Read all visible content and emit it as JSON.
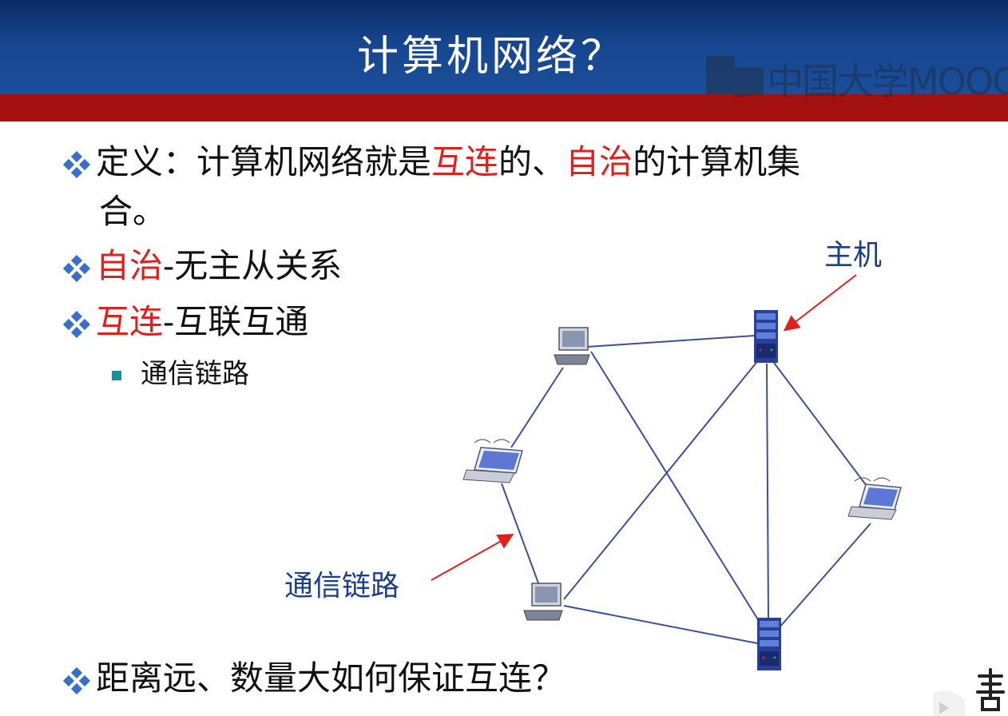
{
  "header": {
    "title": "计算机网络？"
  },
  "watermark": {
    "text": "中国大学MOOC"
  },
  "bullets": [
    {
      "line1_pre": "定义：计算机网络就是",
      "red1": "互连",
      "mid": "的、",
      "red2": "自治",
      "line1_post": "的计算机集",
      "line2": "合。"
    },
    {
      "red": "自治",
      "rest": "-无主从关系"
    },
    {
      "red": "互连",
      "rest": "-互联互通"
    },
    {
      "text": "距离远、数量大如何保证互连？"
    }
  ],
  "sub_bullet": {
    "text": "通信链路"
  },
  "diagram": {
    "host_label": "主机",
    "link_label": "通信链路"
  },
  "colors": {
    "red_text": "#e0201c",
    "header_blue": "#16468f",
    "band_red": "#a31010",
    "link_line": "#3a4fa0",
    "arrow": "#e0201c"
  }
}
